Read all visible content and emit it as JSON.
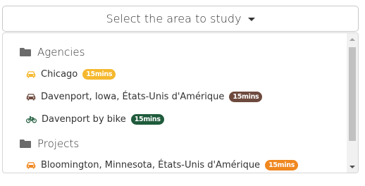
{
  "select": {
    "label": "Select the area to study"
  },
  "groups": [
    {
      "title": "Agencies",
      "items": [
        {
          "mode": "car",
          "label": "Chicago",
          "badge": "15mins",
          "icon_color": "#f5b82e",
          "badge_color": "#f5b82e"
        },
        {
          "mode": "car",
          "label": "Davenport, Iowa, États-Unis d'Amérique",
          "badge": "15mins",
          "icon_color": "#6e4a3e",
          "badge_color": "#6e4a3e"
        },
        {
          "mode": "bike",
          "label": "Davenport by bike",
          "badge": "15mins",
          "icon_color": "#1f5b3c",
          "badge_color": "#1f5b3c"
        }
      ]
    },
    {
      "title": "Projects",
      "items": [
        {
          "mode": "car",
          "label": "Bloomington, Minnesota, États-Unis d'Amérique",
          "badge": "15mins",
          "icon_color": "#f0871f",
          "badge_color": "#f0871f"
        }
      ]
    }
  ],
  "icons": {
    "dropdown": "caret-down-icon",
    "group": "folder-icon",
    "car": "car-icon",
    "bike": "bicycle-icon"
  }
}
